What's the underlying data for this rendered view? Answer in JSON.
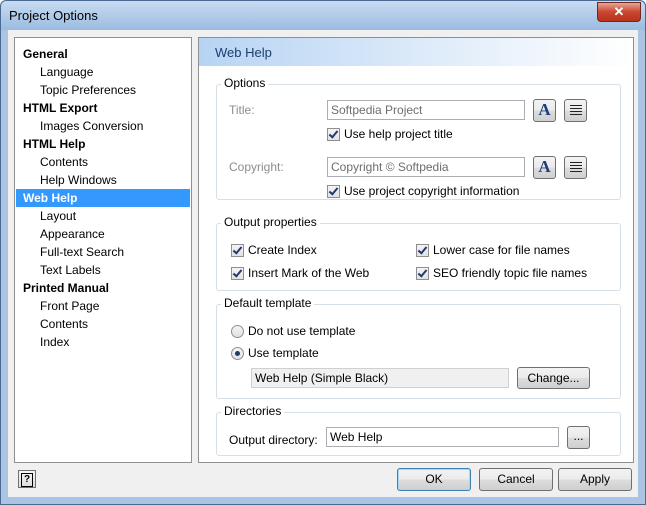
{
  "window": {
    "title": "Project Options",
    "close_glyph": "✕"
  },
  "nav": {
    "items": [
      {
        "label": "General",
        "type": "category"
      },
      {
        "label": "Language",
        "type": "sub"
      },
      {
        "label": "Topic Preferences",
        "type": "sub"
      },
      {
        "label": "HTML Export",
        "type": "category"
      },
      {
        "label": "Images Conversion",
        "type": "sub"
      },
      {
        "label": "HTML Help",
        "type": "category"
      },
      {
        "label": "Contents",
        "type": "sub"
      },
      {
        "label": "Help Windows",
        "type": "sub"
      },
      {
        "label": "Web Help",
        "type": "category",
        "selected": true
      },
      {
        "label": "Layout",
        "type": "sub"
      },
      {
        "label": "Appearance",
        "type": "sub"
      },
      {
        "label": "Full-text Search",
        "type": "sub"
      },
      {
        "label": "Text Labels",
        "type": "sub"
      },
      {
        "label": "Printed Manual",
        "type": "category"
      },
      {
        "label": "Front Page",
        "type": "sub"
      },
      {
        "label": "Contents",
        "type": "sub"
      },
      {
        "label": "Index",
        "type": "sub"
      }
    ],
    "selected_color": "#3399ff"
  },
  "content": {
    "title": "Web Help",
    "options": {
      "group_label": "Options",
      "title_label": "Title:",
      "title_value": "Softpedia Project",
      "use_title_label": "Use help project title",
      "copyright_label": "Copyright:",
      "copyright_value": "Copyright © Softpedia",
      "use_copyright_label": "Use project copyright information",
      "font_button_glyph": "A",
      "font_icon": "font-icon",
      "align_icon": "align-justify-icon"
    },
    "output": {
      "group_label": "Output properties",
      "create_index": "Create Index",
      "insert_mark": "Insert Mark of the Web",
      "lower_case": "Lower case for file names",
      "seo_friendly": "SEO friendly topic file names"
    },
    "template": {
      "group_label": "Default template",
      "no_template": "Do not use template",
      "use_template": "Use template",
      "template_value": "Web Help (Simple Black)",
      "change_button": "Change..."
    },
    "directories": {
      "group_label": "Directories",
      "output_label": "Output directory:",
      "output_value": "Web Help",
      "browse_button": "..."
    }
  },
  "footer": {
    "help_glyph": "?",
    "ok": "OK",
    "cancel": "Cancel",
    "apply": "Apply"
  },
  "colors": {
    "accent": "#3399ff",
    "header_title": "#1b3d6e",
    "titlebar": "#aac4e2"
  }
}
